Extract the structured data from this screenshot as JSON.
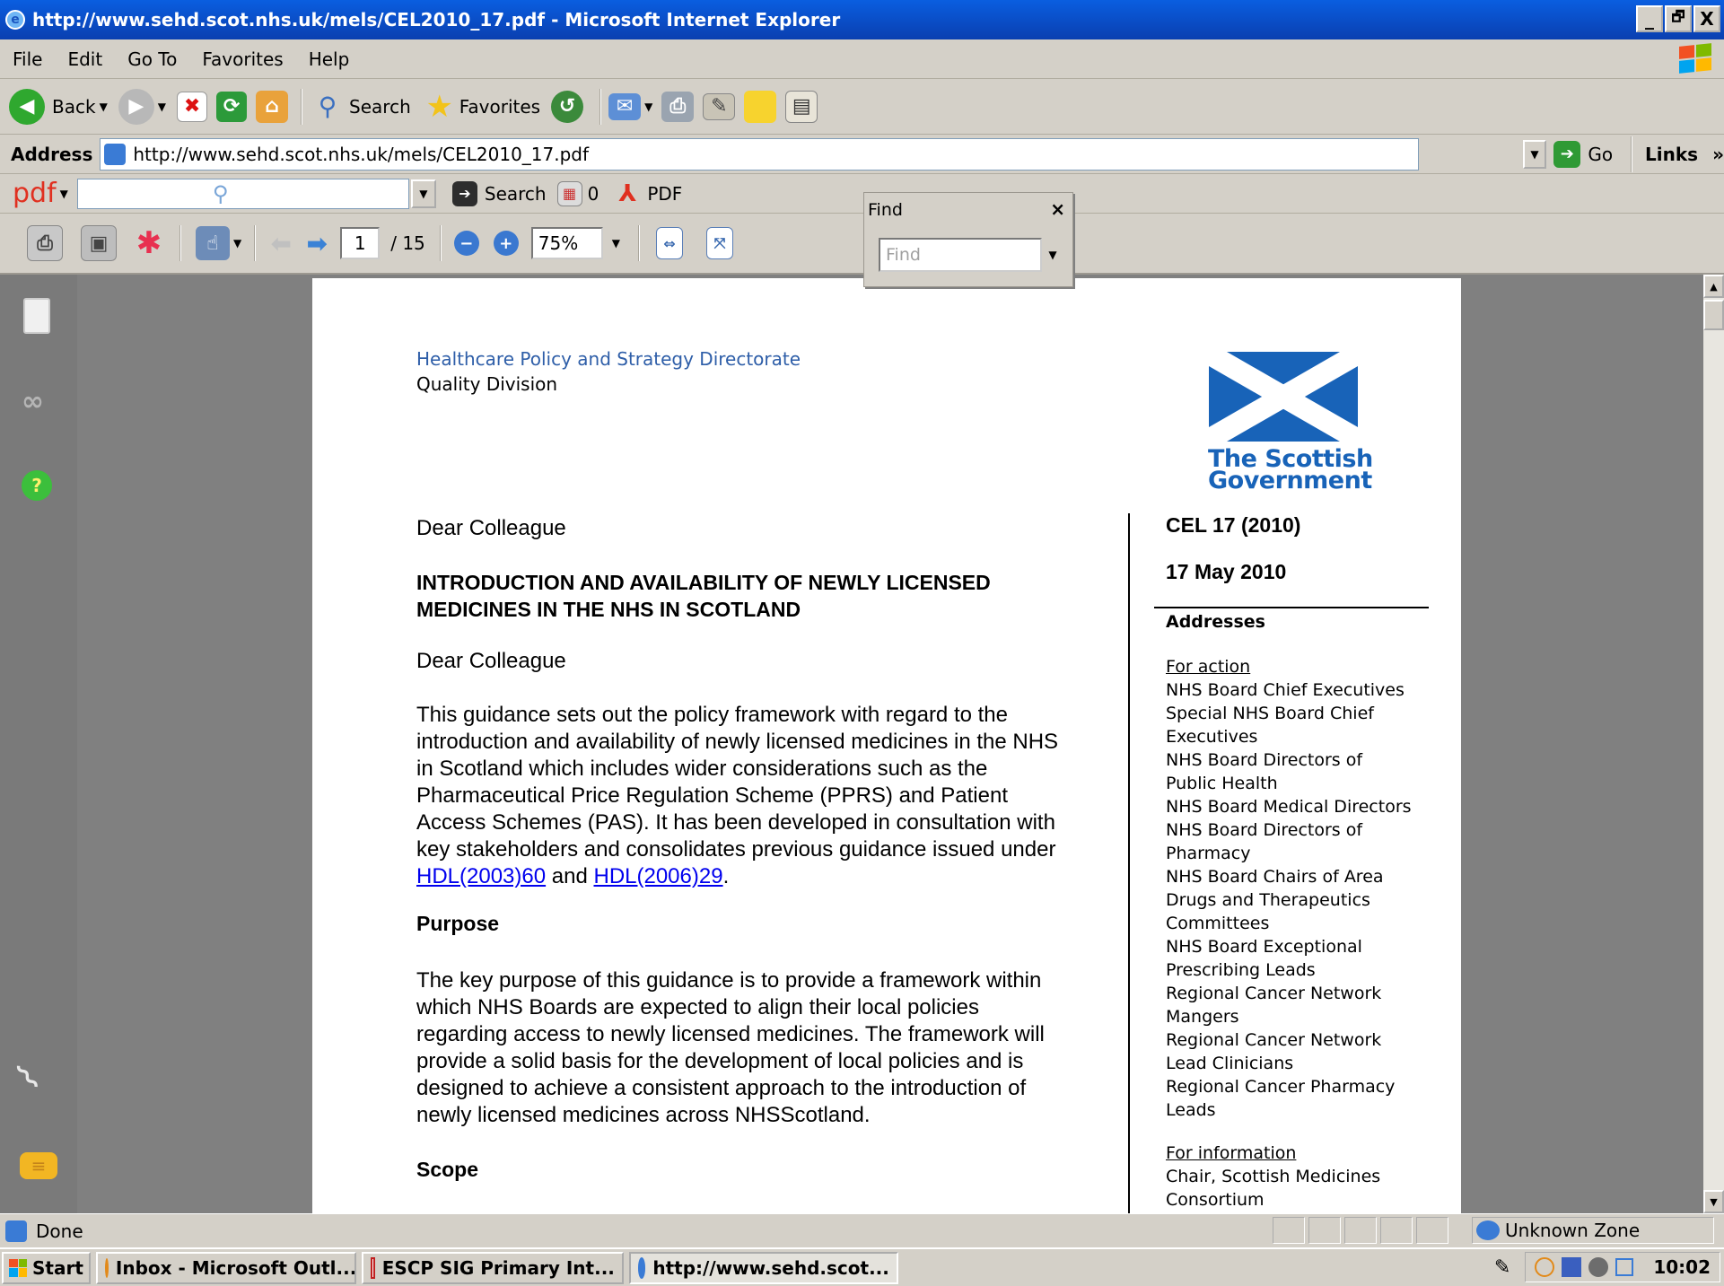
{
  "window": {
    "title": "http://www.sehd.scot.nhs.uk/mels/CEL2010_17.pdf - Microsoft Internet Explorer",
    "min": "_",
    "max": "🗗",
    "close": "X"
  },
  "menu": [
    "File",
    "Edit",
    "Go To",
    "Favorites",
    "Help"
  ],
  "toolbar": {
    "back": "Back",
    "search": "Search",
    "favorites": "Favorites"
  },
  "address": {
    "label": "Address",
    "url": "http://www.sehd.scot.nhs.uk/mels/CEL2010_17.pdf",
    "go": "Go",
    "links": "Links"
  },
  "pdfbar": {
    "logo": "pdf",
    "search_label": "Search",
    "count": "0",
    "pdf_label": "PDF"
  },
  "pdftools": {
    "page": "1",
    "total": "/ 15",
    "zoom": "75%"
  },
  "find": {
    "title": "Find",
    "close": "×",
    "placeholder": "Find"
  },
  "doc": {
    "directorate": "Healthcare Policy and Strategy Directorate",
    "division": "Quality Division",
    "logo_line1": "The Scottish",
    "logo_line2": "Government",
    "salutation1": "Dear Colleague",
    "heading_l1": "INTRODUCTION AND AVAILABILITY OF NEWLY LICENSED",
    "heading_l2": "MEDICINES IN THE NHS IN SCOTLAND",
    "salutation2": "Dear Colleague",
    "para1": [
      "This guidance sets out the policy framework with regard to the",
      "introduction and availability of newly licensed medicines in the NHS",
      "in Scotland which includes wider considerations such as the",
      "Pharmaceutical Price Regulation Scheme (PPRS) and Patient",
      "Access Schemes (PAS).  It has been developed in consultation with",
      "key stakeholders and consolidates previous guidance issued under"
    ],
    "link1": "HDL(2003)60",
    "and": " and ",
    "link2": "HDL(2006)29",
    "period": ".",
    "purpose": "Purpose",
    "para2": [
      "The key purpose of this guidance is to provide a framework within",
      "which NHS Boards are expected to align their local policies",
      "regarding access to newly licensed medicines.  The framework will",
      "provide a solid basis for the development of local policies and is",
      "designed to achieve a consistent approach to the introduction of",
      "newly licensed medicines across NHSScotland."
    ],
    "scope": "Scope",
    "cel": "CEL 17 (2010)",
    "date": "17 May 2010",
    "addresses": "Addresses",
    "for_action": "For action",
    "action_lines": [
      "NHS Board Chief Executives",
      "Special NHS Board Chief",
      "Executives",
      "NHS Board Directors of",
      "Public Health",
      "NHS Board Medical Directors",
      "NHS Board Directors of",
      "Pharmacy",
      "NHS Board Chairs of Area",
      "Drugs and Therapeutics",
      "Committees",
      "NHS Board Exceptional",
      "Prescribing Leads",
      "Regional Cancer Network",
      "Mangers",
      "Regional Cancer Network",
      "Lead Clinicians",
      "Regional Cancer Pharmacy",
      "Leads"
    ],
    "for_information": "For information",
    "info_lines": [
      "Chair, Scottish Medicines",
      "Consortium"
    ]
  },
  "status": {
    "text": "Done",
    "zone": "Unknown Zone"
  },
  "taskbar": {
    "start": "Start",
    "tasks": [
      "Inbox - Microsoft Outl...",
      "ESCP SIG Primary Int...",
      "http://www.sehd.scot..."
    ],
    "clock": "10:02"
  }
}
